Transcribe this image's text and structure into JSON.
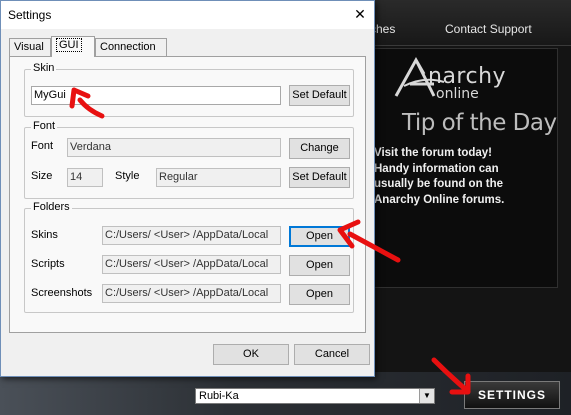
{
  "launcher": {
    "nav": {
      "patches_partial": "ches",
      "contact_support": "Contact Support"
    },
    "logo": {
      "name": "narchy",
      "sub": "online"
    },
    "tip_title": "Tip of the Day",
    "tip_body": "Visit the forum today!\nHandy information can\nusually be found on the\nAnarchy Online forums.",
    "server": "Rubi-Ka",
    "settings_button": "SETTINGS"
  },
  "dialog": {
    "title": "Settings",
    "close": "✕",
    "tabs": [
      "Visual",
      "GUI",
      "Connection"
    ],
    "active_tab": "GUI",
    "skin": {
      "group_label": "Skin",
      "value": "MyGui",
      "set_default": "Set Default"
    },
    "font": {
      "group_label": "Font",
      "font_label": "Font",
      "font_value": "Verdana",
      "change": "Change",
      "size_label": "Size",
      "size_value": "14",
      "style_label": "Style",
      "style_value": "Regular",
      "set_default": "Set Default"
    },
    "folders": {
      "group_label": "Folders",
      "skins_label": "Skins",
      "skins_path": "C:/Users/  <User>  /AppData/Local",
      "scripts_label": "Scripts",
      "scripts_path": "C:/Users/  <User>  /AppData/Local",
      "screenshots_label": "Screenshots",
      "screenshots_path": "C:/Users/  <User>  /AppData/Local",
      "open": "Open"
    },
    "ok": "OK",
    "cancel": "Cancel"
  },
  "colors": {
    "annotation_arrow": "#e81010",
    "focus_border": "#0078d7"
  }
}
